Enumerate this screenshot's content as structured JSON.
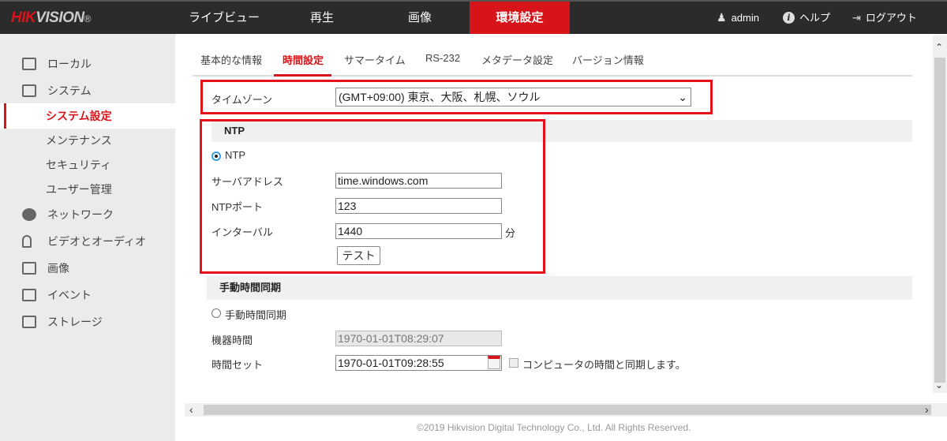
{
  "header": {
    "logo": "HIKVISION",
    "logo_accent": "HIK",
    "logo_rest": "VISION",
    "logo_mark": "®",
    "nav": [
      "ライブビュー",
      "再生",
      "画像",
      "環境設定"
    ],
    "active_nav": 3,
    "user": "admin",
    "help": "ヘルプ",
    "logout": "ログアウト"
  },
  "sidebar": {
    "items": [
      {
        "label": "ローカル",
        "icon": "monitor-icon"
      },
      {
        "label": "システム",
        "icon": "window-icon"
      },
      {
        "label": "システム設定",
        "sub": true,
        "active": true
      },
      {
        "label": "メンテナンス",
        "sub": true
      },
      {
        "label": "セキュリティ",
        "sub": true
      },
      {
        "label": "ユーザー管理",
        "sub": true
      },
      {
        "label": "ネットワーク",
        "icon": "globe-icon"
      },
      {
        "label": "ビデオとオーディオ",
        "icon": "microphone-video-icon"
      },
      {
        "label": "画像",
        "icon": "image-icon"
      },
      {
        "label": "イベント",
        "icon": "calendar-list-icon"
      },
      {
        "label": "ストレージ",
        "icon": "floppy-disk-icon"
      }
    ]
  },
  "tabs": [
    "基本的な情報",
    "時間設定",
    "サマータイム",
    "RS-232",
    "メタデータ設定",
    "バージョン情報"
  ],
  "active_tab": 1,
  "timezone": {
    "label": "タイムゾーン",
    "value": "(GMT+09:00) 東京、大阪、札幌、ソウル"
  },
  "ntp": {
    "section": "NTP",
    "radio_label": "NTP",
    "selected": true,
    "server_label": "サーバアドレス",
    "server_value": "time.windows.com",
    "port_label": "NTPポート",
    "port_value": "123",
    "interval_label": "インターバル",
    "interval_value": "1440",
    "interval_unit": "分",
    "test_button": "テスト"
  },
  "manual": {
    "section": "手動時間同期",
    "radio_label": "手動時間同期",
    "selected": false,
    "device_time_label": "機器時間",
    "device_time_value": "1970-01-01T08:29:07",
    "set_time_label": "時間セット",
    "set_time_value": "1970-01-01T09:28:55",
    "sync_label": "コンピュータの時間と同期します。",
    "sync_checked": false
  },
  "footer": "©2019 Hikvision Digital Technology Co., Ltd. All Rights Reserved.",
  "colors": {
    "accent": "#d7141a",
    "topbar": "#2b2b2b",
    "sidebar": "#ebebeb",
    "highlight_box": "#e5121b"
  }
}
